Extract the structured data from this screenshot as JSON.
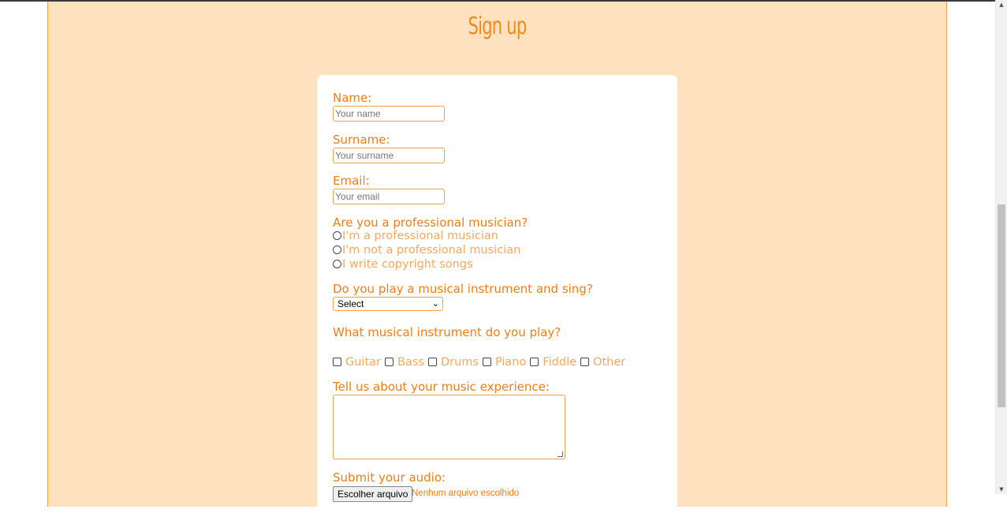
{
  "page": {
    "title": "Sign up"
  },
  "form": {
    "name_label": "Name:",
    "name_placeholder": "Your name",
    "surname_label": "Surname:",
    "surname_placeholder": "Your surname",
    "email_label": "Email:",
    "email_placeholder": "Your email",
    "professional_question": "Are you a professional musician?",
    "professional_options": [
      "I'm a professional musician",
      "I'm not a professional musician",
      "I write copyright songs"
    ],
    "sing_question": "Do you play a musical instrument and sing?",
    "sing_selected": "Select",
    "instrument_question": "What musical instrument do you play?",
    "instruments": [
      "Guitar",
      "Bass",
      "Drums",
      "Piano",
      "Fiddle",
      "Other"
    ],
    "experience_label": "Tell us about your music experience:",
    "audio_label": "Submit your audio:",
    "file_button": "Escolher arquivo",
    "file_status": "Nenhum arquivo escolhido"
  },
  "colors": {
    "page_bg": "#fee2c0",
    "accent": "#f07d16",
    "option_text": "#f6a860",
    "card_bg": "#ffffff"
  }
}
